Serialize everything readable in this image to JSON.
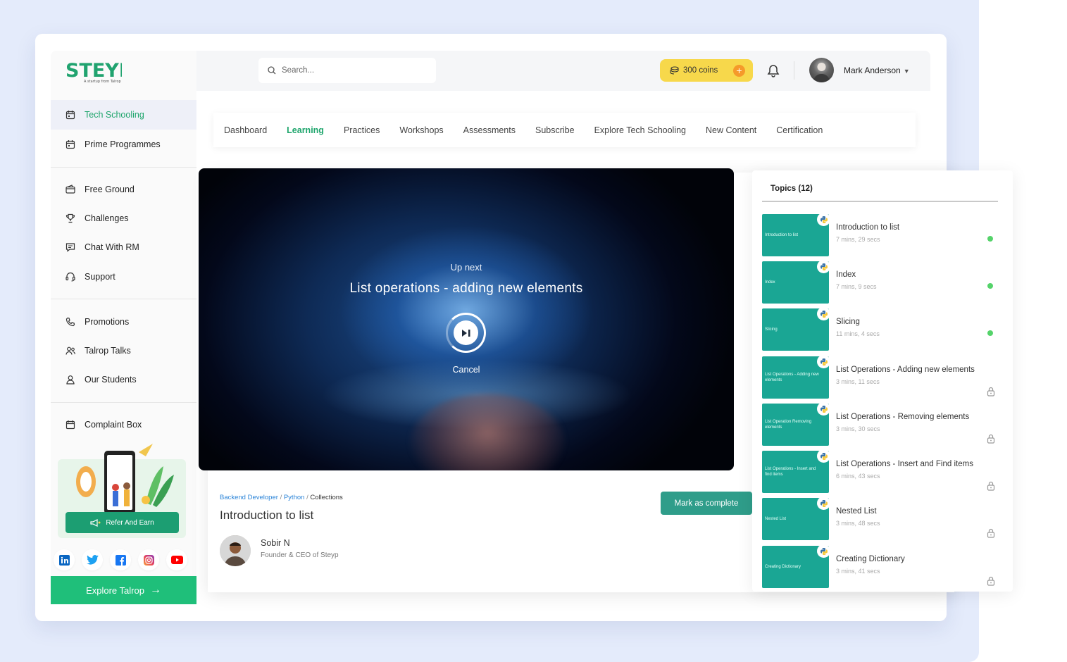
{
  "brand": {
    "logo": "STEYP",
    "tagline": "A startup from Talrop"
  },
  "header": {
    "search_placeholder": "Search...",
    "coins_label": "300 coins",
    "coins_add": "+",
    "user_name": "Mark Anderson"
  },
  "sidebar": {
    "groups": [
      [
        {
          "label": "Tech Schooling",
          "icon": "calendar-icon",
          "active": true
        },
        {
          "label": "Prime Programmes",
          "icon": "calendar-icon"
        }
      ],
      [
        {
          "label": "Free Ground",
          "icon": "wallet-icon"
        },
        {
          "label": "Challenges",
          "icon": "trophy-icon"
        },
        {
          "label": "Chat With RM",
          "icon": "chat-icon"
        },
        {
          "label": "Support",
          "icon": "headset-icon"
        }
      ],
      [
        {
          "label": "Promotions",
          "icon": "phone-icon"
        },
        {
          "label": "Talrop Talks",
          "icon": "users-icon"
        },
        {
          "label": "Our Students",
          "icon": "user-icon"
        }
      ],
      [
        {
          "label": "Complaint Box",
          "icon": "box-icon"
        }
      ]
    ],
    "refer_label": "Refer And Earn",
    "socials": [
      "linkedin-icon",
      "twitter-icon",
      "facebook-icon",
      "instagram-icon",
      "youtube-icon"
    ],
    "explore_label": "Explore Talrop"
  },
  "tabs": [
    "Dashboard",
    "Learning",
    "Practices",
    "Workshops",
    "Assessments",
    "Subscribe",
    "Explore Tech Schooling",
    "New Content",
    "Certification"
  ],
  "active_tab": "Learning",
  "video": {
    "up_next_label": "Up next",
    "next_title": "List operations - adding  new elements",
    "cancel_label": "Cancel"
  },
  "lesson": {
    "breadcrumb": [
      "Backend Developer",
      "Python",
      "Collections"
    ],
    "title": "Introduction to list",
    "mark_complete_label": "Mark as complete",
    "author_name": "Sobir N",
    "author_role": "Founder & CEO of Steyp"
  },
  "topics": {
    "heading": "Topics (12)",
    "items": [
      {
        "thumb": "Introduction to list",
        "title": "Introduction to list",
        "duration": "7 mins, 29 secs",
        "status": "done"
      },
      {
        "thumb": "Index",
        "title": "Index",
        "duration": "7 mins, 9 secs",
        "status": "done"
      },
      {
        "thumb": "Slicing",
        "title": "Slicing",
        "duration": "11 mins, 4 secs",
        "status": "done"
      },
      {
        "thumb": "List Operations - Adding new elements",
        "title": "List Operations - Adding new elements",
        "duration": "3 mins, 11 secs",
        "status": "locked"
      },
      {
        "thumb": "List Operation Removing elements",
        "title": "List Operations - Removing elements",
        "duration": "3 mins, 30 secs",
        "status": "locked"
      },
      {
        "thumb": "List Operations - Insert and find items",
        "title": "List Operations - Insert and Find items",
        "duration": "6 mins, 43 secs",
        "status": "locked"
      },
      {
        "thumb": "Nested List",
        "title": "Nested List",
        "duration": "3 mins, 48 secs",
        "status": "locked"
      },
      {
        "thumb": "Creating Dictionary",
        "title": "Creating Dictionary",
        "duration": "3 mins, 41 secs",
        "status": "locked"
      }
    ]
  },
  "colors": {
    "accent": "#1ea56c",
    "topic_thumb": "#1aa694",
    "coins_bg": "#f7d84b",
    "link": "#2b84d8"
  }
}
